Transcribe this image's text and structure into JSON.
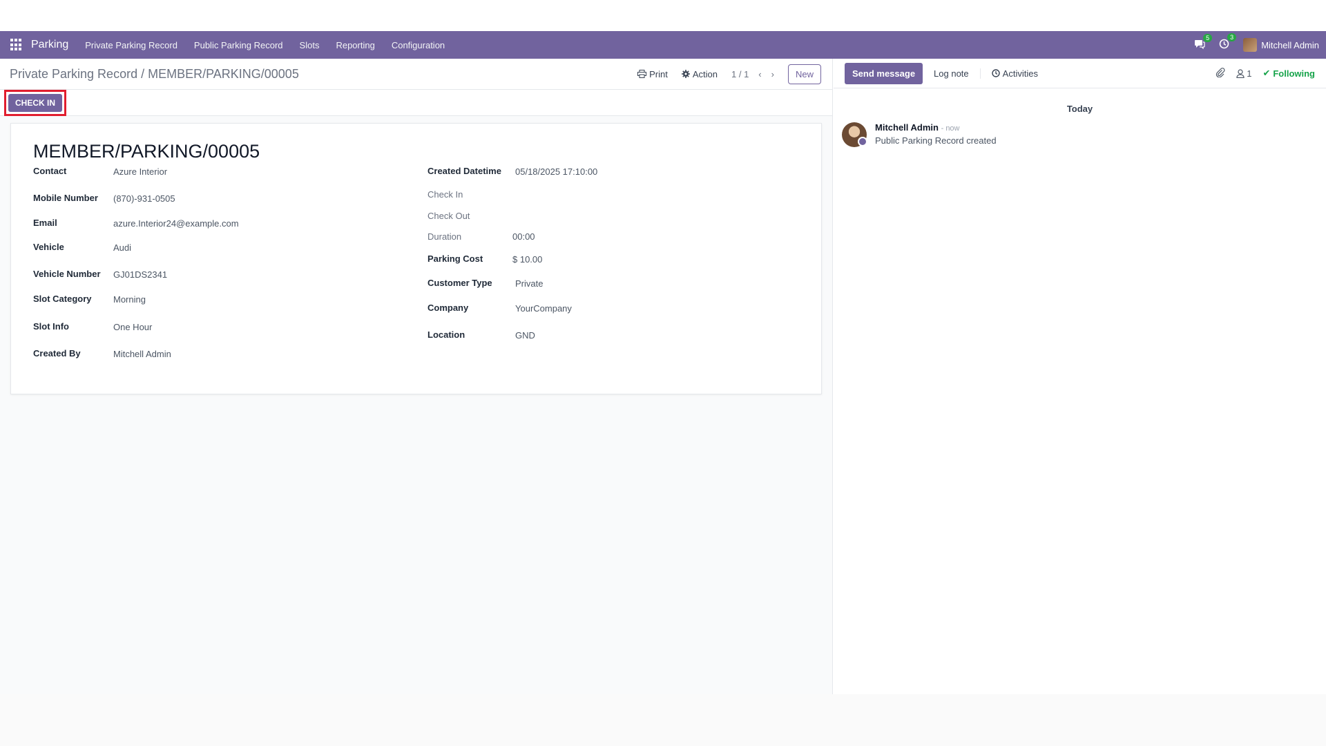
{
  "navbar": {
    "brand": "Parking",
    "items": [
      "Private Parking Record",
      "Public Parking Record",
      "Slots",
      "Reporting",
      "Configuration"
    ],
    "messages_badge": "5",
    "activities_badge": "3",
    "user_name": "Mitchell Admin"
  },
  "control_panel": {
    "breadcrumb": "Private Parking Record / MEMBER/PARKING/00005",
    "print_label": "Print",
    "action_label": "Action",
    "pager": "1 / 1",
    "new_label": "New"
  },
  "status_bar": {
    "checkin_label": "CHECK IN"
  },
  "record": {
    "title": "MEMBER/PARKING/00005",
    "left_fields": [
      {
        "label": "Contact",
        "value": "Azure Interior"
      },
      {
        "label": "Mobile Number",
        "value": "(870)-931-0505"
      },
      {
        "label": "Email",
        "value": "azure.Interior24@example.com"
      },
      {
        "label": "Vehicle",
        "value": "Audi"
      },
      {
        "label": "Vehicle Number",
        "value": "GJ01DS2341"
      },
      {
        "label": "Slot Category",
        "value": "Morning"
      },
      {
        "label": "Slot Info",
        "value": "One Hour"
      },
      {
        "label": "Created By",
        "value": "Mitchell Admin"
      }
    ],
    "right_fields": [
      {
        "label": "Created Datetime",
        "value": "05/18/2025 17:10:00"
      },
      {
        "label": "Check In",
        "value": ""
      },
      {
        "label": "Check Out",
        "value": ""
      },
      {
        "label": "Duration",
        "value": "00:00"
      },
      {
        "label": "Parking Cost",
        "value": "$ 10.00"
      },
      {
        "label": "Customer Type",
        "value": "Private"
      },
      {
        "label": "Company",
        "value": "YourCompany"
      },
      {
        "label": "Location",
        "value": "GND"
      }
    ]
  },
  "chatter": {
    "send_message": "Send message",
    "log_note": "Log note",
    "activities": "Activities",
    "followers_count": "1",
    "following": "Following",
    "date_separator": "Today",
    "message": {
      "author": "Mitchell Admin",
      "time": "- now",
      "body": "Public Parking Record created"
    }
  },
  "colors": {
    "brand": "#71639e",
    "highlight": "#e11d2e",
    "following": "#16a34a"
  }
}
